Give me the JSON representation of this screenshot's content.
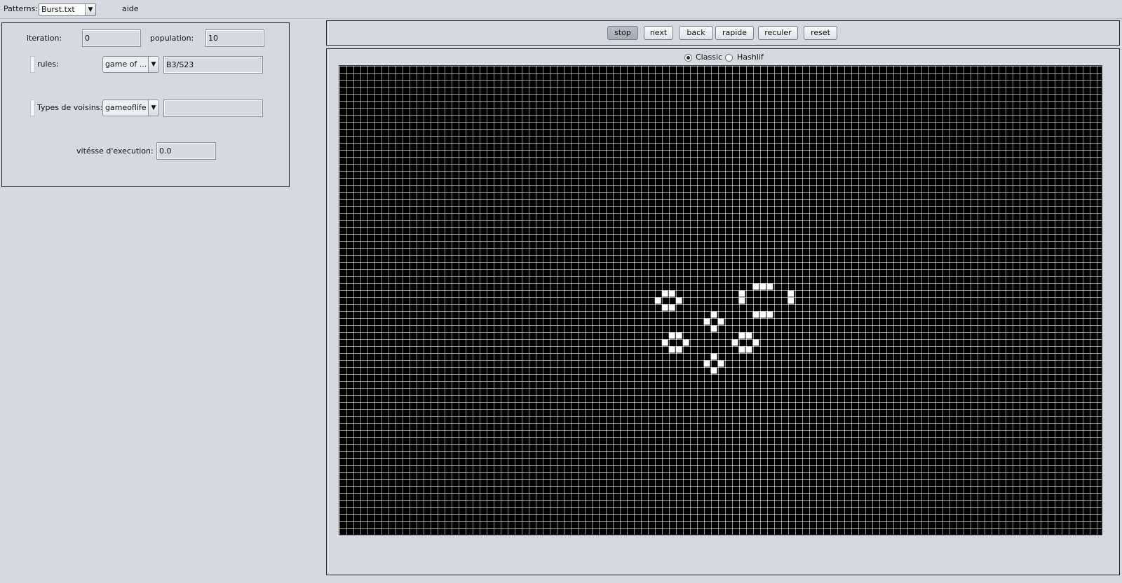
{
  "menubar": {
    "patterns_label": "Patterns:",
    "patterns_value": "Burst.txt",
    "aide_label": "aide"
  },
  "stats": {
    "iteration_label": "iteration:",
    "iteration_value": "0",
    "population_label": "population:",
    "population_value": "10"
  },
  "rules": {
    "label": "rules:",
    "combo_value": "game of ...",
    "rule_value": "B3/S23"
  },
  "neighbors": {
    "label": "Types de voisins:",
    "combo_value": "gameoflife",
    "text_value": ""
  },
  "speed": {
    "label": "vitésse d'execution:",
    "value": "0.0"
  },
  "controls": {
    "stop": "stop",
    "next": "next",
    "back": "back",
    "rapide": "rapide",
    "reculer": "reculer",
    "reset": "reset"
  },
  "mode": {
    "classic_label": "Classic",
    "hashlife_label": "Hashlif",
    "selected": "Classic"
  },
  "grid": {
    "columns": 109,
    "rows": 67,
    "background_color": "#000000",
    "cell_color": "#ffffff",
    "line_color": "#9a9a9a",
    "live_cells": [
      [
        46,
        32
      ],
      [
        47,
        32
      ],
      [
        45,
        33
      ],
      [
        48,
        33
      ],
      [
        46,
        34
      ],
      [
        47,
        34
      ],
      [
        59,
        31
      ],
      [
        60,
        31
      ],
      [
        61,
        31
      ],
      [
        57,
        32
      ],
      [
        64,
        32
      ],
      [
        57,
        33
      ],
      [
        64,
        33
      ],
      [
        59,
        35
      ],
      [
        60,
        35
      ],
      [
        61,
        35
      ],
      [
        53,
        35
      ],
      [
        52,
        36
      ],
      [
        54,
        36
      ],
      [
        53,
        37
      ],
      [
        47,
        38
      ],
      [
        48,
        38
      ],
      [
        46,
        39
      ],
      [
        49,
        39
      ],
      [
        47,
        40
      ],
      [
        48,
        40
      ],
      [
        57,
        38
      ],
      [
        58,
        38
      ],
      [
        56,
        39
      ],
      [
        59,
        39
      ],
      [
        57,
        40
      ],
      [
        58,
        40
      ],
      [
        53,
        41
      ],
      [
        52,
        42
      ],
      [
        54,
        42
      ],
      [
        53,
        43
      ]
    ]
  }
}
